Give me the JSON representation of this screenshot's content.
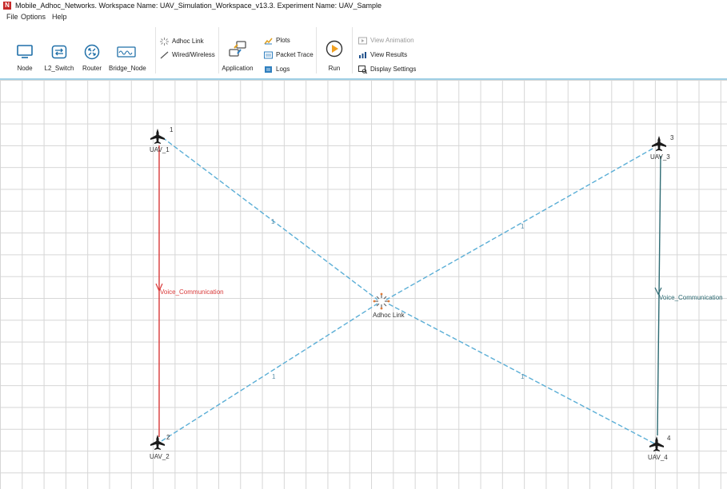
{
  "window": {
    "title": "Mobile_Adhoc_Networks. Workspace Name: UAV_Simulation_Workspace_v13.3. Experiment Name: UAV_Sample",
    "logo_letter": "N"
  },
  "menu": [
    "File",
    "Options",
    "Help"
  ],
  "ribbon": {
    "node": "Node",
    "l2_switch": "L2_Switch",
    "router": "Router",
    "bridge_node": "Bridge_Node",
    "adhoc_link": "Adhoc Link",
    "wired_wireless": "Wired/Wireless",
    "application": "Application",
    "plots": "Plots",
    "packet_trace": "Packet Trace",
    "logs": "Logs",
    "run": "Run",
    "view_animation": "View Animation",
    "view_results": "View Results",
    "display_settings": "Display Settings"
  },
  "colors": {
    "accent": "#2f7fbf",
    "adhoc_link_line": "#5aaed6",
    "app_link_red": "#d93a3a",
    "app_link_teal": "#2e6b73",
    "grid": "#d6d6d6"
  },
  "canvas": {
    "nodes": [
      {
        "id": "1",
        "name": "UAV_1",
        "icon": "aircraft-icon"
      },
      {
        "id": "2",
        "name": "UAV_2",
        "icon": "aircraft-icon"
      },
      {
        "id": "3",
        "name": "UAV_3",
        "icon": "aircraft-icon"
      },
      {
        "id": "4",
        "name": "UAV_4",
        "icon": "aircraft-icon"
      }
    ],
    "adhoc_link": {
      "label": "Adhoc Link",
      "icon": "adhoc-link-icon"
    },
    "link_labels": [
      "1",
      "1",
      "1",
      "1"
    ],
    "applications": [
      {
        "name": "Voice_Communication",
        "from": "UAV_1",
        "to": "UAV_2",
        "color": "#d93a3a"
      },
      {
        "name": "Voice_Communication",
        "from": "UAV_3",
        "to": "UAV_4",
        "color": "#2e6b73"
      }
    ]
  }
}
